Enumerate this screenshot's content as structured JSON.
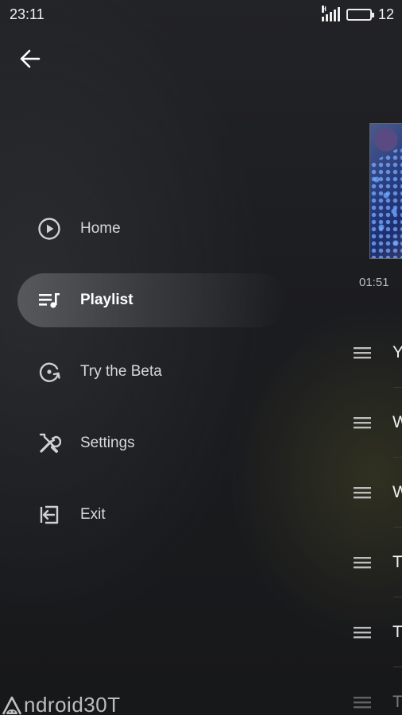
{
  "status_bar": {
    "time": "23:11",
    "battery_level": "12"
  },
  "menu": {
    "items": [
      {
        "label": "Home",
        "icon": "play-circle-icon",
        "active": false
      },
      {
        "label": "Playlist",
        "icon": "playlist-music-icon",
        "active": true
      },
      {
        "label": "Try the Beta",
        "icon": "beta-update-icon",
        "active": false
      },
      {
        "label": "Settings",
        "icon": "tools-icon",
        "active": false
      },
      {
        "label": "Exit",
        "icon": "exit-icon",
        "active": false
      }
    ]
  },
  "player": {
    "elapsed": "01:51"
  },
  "queue": {
    "items": [
      {
        "initial": "Y"
      },
      {
        "initial": "W"
      },
      {
        "initial": "W"
      },
      {
        "initial": "T"
      },
      {
        "initial": "T"
      },
      {
        "initial": "T"
      }
    ]
  },
  "watermark": {
    "text": "ndroid30T"
  },
  "colors": {
    "accent": "#ffffff",
    "background": "#1b1c1f",
    "active_pill": "#5f6064"
  }
}
